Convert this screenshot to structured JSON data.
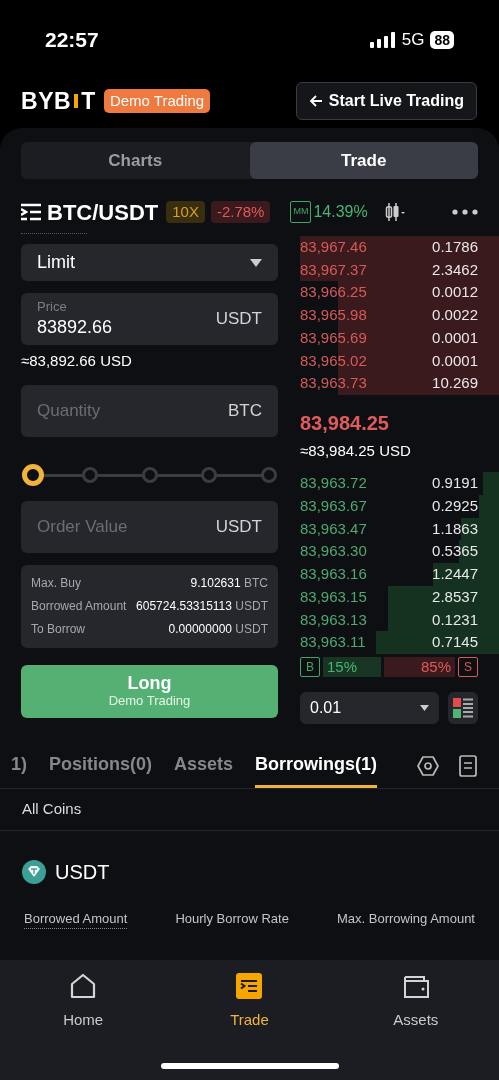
{
  "status_bar": {
    "time": "22:57",
    "network": "5G",
    "battery": "88"
  },
  "header": {
    "logo_left": "BYB",
    "logo_right": "T",
    "badge": "Demo Trading",
    "live_button": "Start Live Trading"
  },
  "view_tabs": [
    {
      "label": "Charts",
      "selected": false
    },
    {
      "label": "Trade",
      "selected": true
    }
  ],
  "pair": {
    "symbol": "BTC/USDT",
    "leverage": "10X",
    "change": "-2.78%",
    "mm_label": "MM",
    "mm_value": "14.39%"
  },
  "order_form": {
    "order_type": "Limit",
    "price": {
      "placeholder": "Price",
      "value": "83892.66",
      "unit": "USDT"
    },
    "price_usd": "≈83,892.66 USD",
    "quantity": {
      "placeholder": "Quantity",
      "unit": "BTC"
    },
    "slider": {
      "level": 0
    },
    "order_value": {
      "placeholder": "Order Value",
      "unit": "USDT"
    },
    "info": [
      {
        "label": "Max. Buy",
        "value": "9.102631",
        "unit": "BTC"
      },
      {
        "label": "Borrowed Amount",
        "value": "605724.53315113",
        "unit": "USDT"
      },
      {
        "label": "To Borrow",
        "value": "0.00000000",
        "unit": "USDT"
      }
    ],
    "submit": {
      "label": "Long",
      "sublabel": "Demo Trading"
    }
  },
  "order_book": {
    "asks": [
      {
        "price": "83,967.46",
        "size": "0.1786",
        "level": 1
      },
      {
        "price": "83,967.37",
        "size": "2.3462",
        "level": 1
      },
      {
        "price": "83,966.25",
        "size": "0.0012",
        "level": 0.81
      },
      {
        "price": "83,965.98",
        "size": "0.0022",
        "level": 0.81
      },
      {
        "price": "83,965.69",
        "size": "0.0001",
        "level": 0.81
      },
      {
        "price": "83,965.02",
        "size": "0.0001",
        "level": 0.81
      },
      {
        "price": "83,963.73",
        "size": "10.269",
        "level": 0.81
      }
    ],
    "last_price": "83,984.25",
    "last_price_usd": "≈83,984.25 USD",
    "bids": [
      {
        "price": "83,963.72",
        "size": "0.9191",
        "level": 0.08
      },
      {
        "price": "83,963.67",
        "size": "0.2925",
        "level": 0.1
      },
      {
        "price": "83,963.47",
        "size": "1.1863",
        "level": 0.19
      },
      {
        "price": "83,963.30",
        "size": "0.5365",
        "level": 0.2
      },
      {
        "price": "83,963.16",
        "size": "1.2447",
        "level": 0.33
      },
      {
        "price": "83,963.15",
        "size": "2.8537",
        "level": 0.56
      },
      {
        "price": "83,963.13",
        "size": "0.1231",
        "level": 0.56
      },
      {
        "price": "83,963.11",
        "size": "0.7145",
        "level": 0.62
      }
    ],
    "buy_label": "B",
    "buy_share": "15%",
    "sell_share": "85%",
    "sell_label": "S",
    "tick_size": "0.01"
  },
  "bottom_tabs": [
    {
      "label": "1)",
      "selected": false
    },
    {
      "label": "Positions(0)",
      "selected": false
    },
    {
      "label": "Assets",
      "selected": false
    },
    {
      "label": "Borrowings(1)",
      "selected": true
    }
  ],
  "filter": "All Coins",
  "borrowing": {
    "coin": "USDT",
    "columns": [
      "Borrowed Amount",
      "Hourly Borrow Rate",
      "Max. Borrowing Amount"
    ]
  },
  "nav": [
    {
      "label": "Home",
      "selected": false
    },
    {
      "label": "Trade",
      "selected": true
    },
    {
      "label": "Assets",
      "selected": false
    }
  ]
}
